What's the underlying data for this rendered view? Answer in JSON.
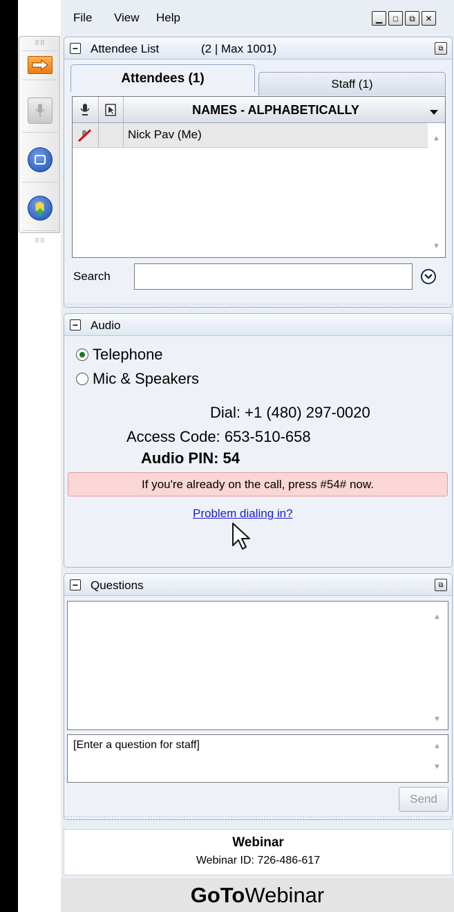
{
  "menu": {
    "file": "File",
    "view": "View",
    "help": "Help"
  },
  "attendee_panel": {
    "title": "Attendee List",
    "count": "(2 | Max 1001)",
    "tabs": [
      {
        "label": "Attendees (1)",
        "active": true
      },
      {
        "label": "Staff (1)",
        "active": false
      }
    ],
    "column_header": "NAMES - ALPHABETICALLY",
    "rows": [
      {
        "name": "Nick Pav (Me)",
        "mic_muted": true
      }
    ],
    "search_label": "Search",
    "search_value": ""
  },
  "audio_panel": {
    "title": "Audio",
    "options": [
      {
        "label": "Telephone",
        "selected": true
      },
      {
        "label": "Mic & Speakers",
        "selected": false
      }
    ],
    "dial": "Dial: +1 (480) 297-0020",
    "access_code": "Access Code: 653-510-658",
    "audio_pin": "Audio PIN: 54",
    "notice": "If you're already on the call, press #54# now.",
    "problem_link": "Problem dialing in?"
  },
  "questions_panel": {
    "title": "Questions",
    "question_placeholder": "[Enter a question for staff]",
    "send_label": "Send"
  },
  "footer": {
    "title": "Webinar",
    "webinar_id": "Webinar ID: 726-486-617"
  },
  "brand": {
    "bold": "GoTo",
    "light": "Webinar"
  },
  "colors": {
    "panel_bg": "#eef2f8",
    "panel_border": "#a7b7cf",
    "notice_bg": "#fbd6d6",
    "link": "#1a1ad6",
    "orange": "#f08a1a"
  },
  "icons": [
    "arrow-right-icon",
    "microphone-icon",
    "screen-icon",
    "raise-hand-icon",
    "pointer-icon",
    "mic-muted-icon",
    "dropdown-arrow-icon",
    "minimize-icon",
    "maximize-icon",
    "restore-icon",
    "close-icon",
    "collapse-icon",
    "popout-icon"
  ]
}
